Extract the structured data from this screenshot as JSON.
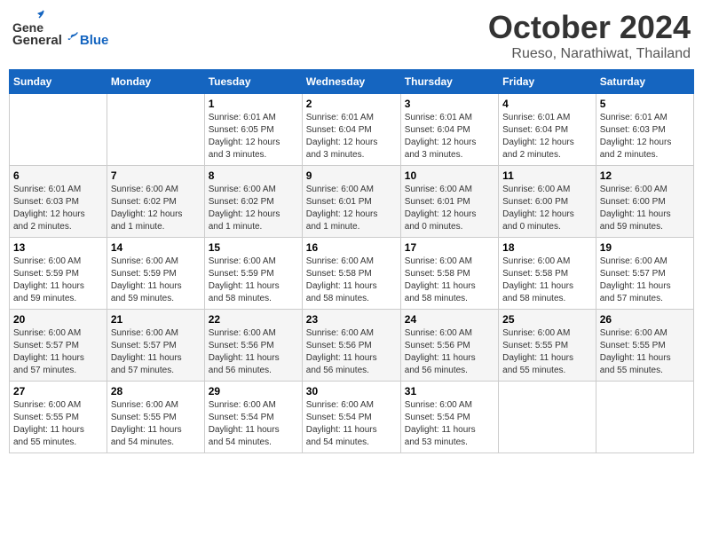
{
  "header": {
    "logo_general": "General",
    "logo_blue": "Blue",
    "month": "October 2024",
    "subtitle": "Rueso, Narathiwat, Thailand"
  },
  "weekdays": [
    "Sunday",
    "Monday",
    "Tuesday",
    "Wednesday",
    "Thursday",
    "Friday",
    "Saturday"
  ],
  "weeks": [
    [
      {
        "day": "",
        "text": ""
      },
      {
        "day": "",
        "text": ""
      },
      {
        "day": "1",
        "text": "Sunrise: 6:01 AM\nSunset: 6:05 PM\nDaylight: 12 hours\nand 3 minutes."
      },
      {
        "day": "2",
        "text": "Sunrise: 6:01 AM\nSunset: 6:04 PM\nDaylight: 12 hours\nand 3 minutes."
      },
      {
        "day": "3",
        "text": "Sunrise: 6:01 AM\nSunset: 6:04 PM\nDaylight: 12 hours\nand 3 minutes."
      },
      {
        "day": "4",
        "text": "Sunrise: 6:01 AM\nSunset: 6:04 PM\nDaylight: 12 hours\nand 2 minutes."
      },
      {
        "day": "5",
        "text": "Sunrise: 6:01 AM\nSunset: 6:03 PM\nDaylight: 12 hours\nand 2 minutes."
      }
    ],
    [
      {
        "day": "6",
        "text": "Sunrise: 6:01 AM\nSunset: 6:03 PM\nDaylight: 12 hours\nand 2 minutes."
      },
      {
        "day": "7",
        "text": "Sunrise: 6:00 AM\nSunset: 6:02 PM\nDaylight: 12 hours\nand 1 minute."
      },
      {
        "day": "8",
        "text": "Sunrise: 6:00 AM\nSunset: 6:02 PM\nDaylight: 12 hours\nand 1 minute."
      },
      {
        "day": "9",
        "text": "Sunrise: 6:00 AM\nSunset: 6:01 PM\nDaylight: 12 hours\nand 1 minute."
      },
      {
        "day": "10",
        "text": "Sunrise: 6:00 AM\nSunset: 6:01 PM\nDaylight: 12 hours\nand 0 minutes."
      },
      {
        "day": "11",
        "text": "Sunrise: 6:00 AM\nSunset: 6:00 PM\nDaylight: 12 hours\nand 0 minutes."
      },
      {
        "day": "12",
        "text": "Sunrise: 6:00 AM\nSunset: 6:00 PM\nDaylight: 11 hours\nand 59 minutes."
      }
    ],
    [
      {
        "day": "13",
        "text": "Sunrise: 6:00 AM\nSunset: 5:59 PM\nDaylight: 11 hours\nand 59 minutes."
      },
      {
        "day": "14",
        "text": "Sunrise: 6:00 AM\nSunset: 5:59 PM\nDaylight: 11 hours\nand 59 minutes."
      },
      {
        "day": "15",
        "text": "Sunrise: 6:00 AM\nSunset: 5:59 PM\nDaylight: 11 hours\nand 58 minutes."
      },
      {
        "day": "16",
        "text": "Sunrise: 6:00 AM\nSunset: 5:58 PM\nDaylight: 11 hours\nand 58 minutes."
      },
      {
        "day": "17",
        "text": "Sunrise: 6:00 AM\nSunset: 5:58 PM\nDaylight: 11 hours\nand 58 minutes."
      },
      {
        "day": "18",
        "text": "Sunrise: 6:00 AM\nSunset: 5:58 PM\nDaylight: 11 hours\nand 58 minutes."
      },
      {
        "day": "19",
        "text": "Sunrise: 6:00 AM\nSunset: 5:57 PM\nDaylight: 11 hours\nand 57 minutes."
      }
    ],
    [
      {
        "day": "20",
        "text": "Sunrise: 6:00 AM\nSunset: 5:57 PM\nDaylight: 11 hours\nand 57 minutes."
      },
      {
        "day": "21",
        "text": "Sunrise: 6:00 AM\nSunset: 5:57 PM\nDaylight: 11 hours\nand 57 minutes."
      },
      {
        "day": "22",
        "text": "Sunrise: 6:00 AM\nSunset: 5:56 PM\nDaylight: 11 hours\nand 56 minutes."
      },
      {
        "day": "23",
        "text": "Sunrise: 6:00 AM\nSunset: 5:56 PM\nDaylight: 11 hours\nand 56 minutes."
      },
      {
        "day": "24",
        "text": "Sunrise: 6:00 AM\nSunset: 5:56 PM\nDaylight: 11 hours\nand 56 minutes."
      },
      {
        "day": "25",
        "text": "Sunrise: 6:00 AM\nSunset: 5:55 PM\nDaylight: 11 hours\nand 55 minutes."
      },
      {
        "day": "26",
        "text": "Sunrise: 6:00 AM\nSunset: 5:55 PM\nDaylight: 11 hours\nand 55 minutes."
      }
    ],
    [
      {
        "day": "27",
        "text": "Sunrise: 6:00 AM\nSunset: 5:55 PM\nDaylight: 11 hours\nand 55 minutes."
      },
      {
        "day": "28",
        "text": "Sunrise: 6:00 AM\nSunset: 5:55 PM\nDaylight: 11 hours\nand 54 minutes."
      },
      {
        "day": "29",
        "text": "Sunrise: 6:00 AM\nSunset: 5:54 PM\nDaylight: 11 hours\nand 54 minutes."
      },
      {
        "day": "30",
        "text": "Sunrise: 6:00 AM\nSunset: 5:54 PM\nDaylight: 11 hours\nand 54 minutes."
      },
      {
        "day": "31",
        "text": "Sunrise: 6:00 AM\nSunset: 5:54 PM\nDaylight: 11 hours\nand 53 minutes."
      },
      {
        "day": "",
        "text": ""
      },
      {
        "day": "",
        "text": ""
      }
    ]
  ]
}
